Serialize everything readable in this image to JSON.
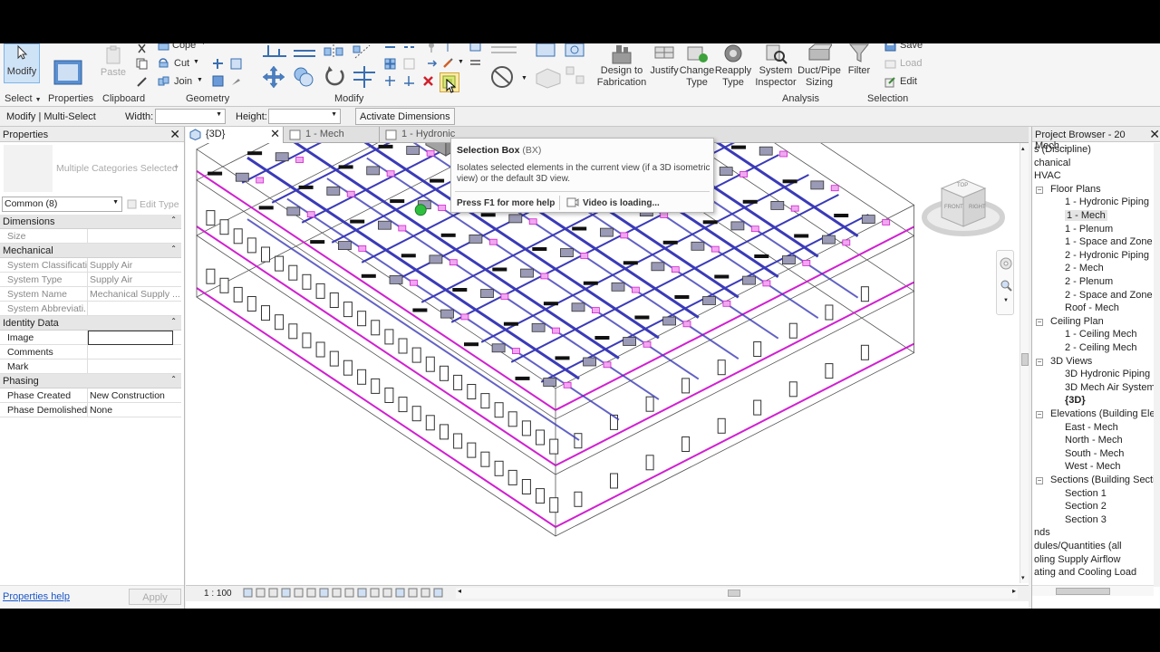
{
  "ribbon": {
    "modify_label": "Modify",
    "paste_label": "Paste",
    "cope_label": "Cope",
    "cut_label": "Cut",
    "join_label": "Join",
    "groups": {
      "select": "Select",
      "properties": "Properties",
      "clipboard": "Clipboard",
      "geometry": "Geometry",
      "modify": "Modify",
      "analysis": "Analysis",
      "selection": "Selection"
    },
    "analysis_buttons": {
      "design_fab_1": "Design to",
      "design_fab_2": "Fabrication",
      "justify": "Justify",
      "change_type_1": "Change",
      "change_type_2": "Type",
      "reapply_1": "Reapply",
      "reapply_2": "Type",
      "sys_insp_1": "System",
      "sys_insp_2": "Inspector",
      "duct_sizing_1": "Duct/Pipe",
      "duct_sizing_2": "Sizing",
      "filter": "Filter"
    },
    "selection_buttons": {
      "save": "Save",
      "load": "Load",
      "edit": "Edit"
    }
  },
  "options_bar": {
    "context": "Modify | Multi-Select",
    "width_label": "Width:",
    "height_label": "Height:",
    "activate_dimensions": "Activate Dimensions"
  },
  "tooltip": {
    "title": "Selection Box",
    "shortcut": "(BX)",
    "description_1": "Isolates selected elements in the current view (if a 3D isometric",
    "description_2": "view) or the default 3D view.",
    "help": "Press F1 for more help",
    "video": "Video is loading..."
  },
  "properties": {
    "title": "Properties",
    "type_selector": "Multiple Categories Selected",
    "filter": "Common (8)",
    "edit_type": "Edit Type",
    "groups": {
      "dimensions": "Dimensions",
      "mechanical": "Mechanical",
      "identity": "Identity Data",
      "phasing": "Phasing"
    },
    "rows": {
      "size": {
        "key": "Size",
        "value": ""
      },
      "sys_class": {
        "key": "System Classificati...",
        "value": "Supply Air"
      },
      "sys_type": {
        "key": "System Type",
        "value": "Supply Air"
      },
      "sys_name": {
        "key": "System Name",
        "value": "Mechanical Supply ..."
      },
      "sys_abbr": {
        "key": "System Abbreviati...",
        "value": ""
      },
      "image": {
        "key": "Image",
        "value": ""
      },
      "comments": {
        "key": "Comments",
        "value": ""
      },
      "mark": {
        "key": "Mark",
        "value": ""
      },
      "phase_created": {
        "key": "Phase Created",
        "value": "New Construction"
      },
      "phase_demolished": {
        "key": "Phase Demolished",
        "value": "None"
      }
    },
    "help_link": "Properties help",
    "apply": "Apply"
  },
  "view_tabs": [
    "{3D}",
    "1 - Mech",
    "1 - Hydronic"
  ],
  "view_status": {
    "scale": "1 : 100"
  },
  "browser": {
    "title": "Project Browser - 20 Mech...",
    "items": [
      "s (Discipline)",
      "chanical",
      "HVAC",
      "Floor Plans",
      "1 - Hydronic Piping",
      "1 - Mech",
      "1 - Plenum",
      "1 - Space and Zone",
      "2 - Hydronic Piping",
      "2 - Mech",
      "2 - Plenum",
      "2 - Space and Zone",
      "Roof - Mech",
      "Ceiling Plan",
      "1 - Ceiling Mech",
      "2 - Ceiling Mech",
      "3D Views",
      "3D Hydronic Piping",
      "3D Mech Air System",
      "{3D}",
      "Elevations (Building Eleva",
      "East - Mech",
      "North - Mech",
      "South - Mech",
      "West - Mech",
      "Sections (Building Section",
      "Section 1",
      "Section 2",
      "Section 3",
      "nds",
      "dules/Quantities (all",
      "oling Supply Airflow",
      "ating and Cooling Load"
    ]
  },
  "colors": {
    "duct": "#3a3ab8",
    "magenta": "#d020d0",
    "equipment": "#909090",
    "ribbon_bg": "#f5f5f5",
    "active_tab": "#ffffff",
    "link": "#1a56c8"
  },
  "viewcube": {
    "top": "TOP",
    "front": "FRONT",
    "right": "RIGHT"
  }
}
